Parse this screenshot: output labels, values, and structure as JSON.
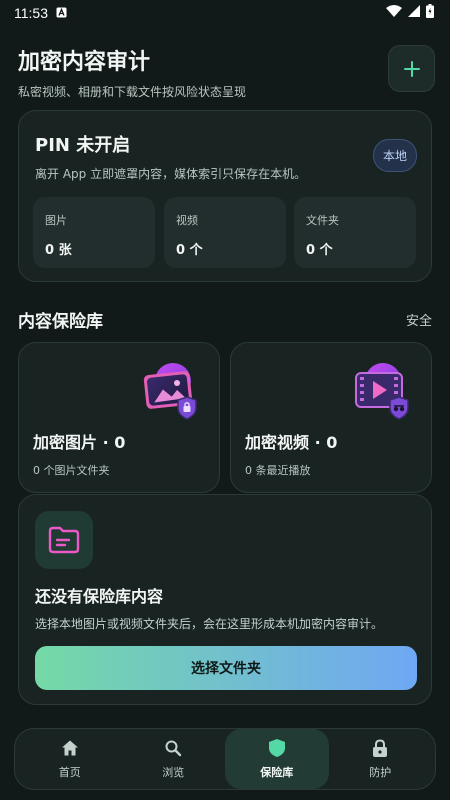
{
  "status_bar": {
    "time": "11:53",
    "icons": [
      "notification-a-icon",
      "wifi-icon",
      "signal-icon",
      "battery-icon"
    ]
  },
  "header": {
    "title": "加密内容审计",
    "subtitle": "私密视频、相册和下载文件按风险状态呈现",
    "add_icon": "plus-icon"
  },
  "pin_card": {
    "title": "PIN 未开启",
    "description": "离开 App 立即遮罩内容，媒体索引只保存在本机。",
    "badge": "本地",
    "stats": [
      {
        "label": "图片",
        "value": "0 张"
      },
      {
        "label": "视频",
        "value": "0 个"
      },
      {
        "label": "文件夹",
        "value": "0 个"
      }
    ]
  },
  "vault_section": {
    "title": "内容保险库",
    "link": "安全",
    "cards": [
      {
        "title": "加密图片 · 0",
        "subtitle": "0 个图片文件夹",
        "icon": "locked-photo-icon"
      },
      {
        "title": "加密视频 · 0",
        "subtitle": "0 条最近播放",
        "icon": "locked-video-icon"
      }
    ]
  },
  "empty_state": {
    "title": "还没有保险库内容",
    "description": "选择本地图片或视频文件夹后，会在这里形成本机加密内容审计。",
    "button": "选择文件夹",
    "icon": "folder-icon"
  },
  "bottom_nav": {
    "items": [
      {
        "label": "首页",
        "icon": "home-icon",
        "active": false
      },
      {
        "label": "浏览",
        "icon": "search-icon",
        "active": false
      },
      {
        "label": "保险库",
        "icon": "shield-icon",
        "active": true
      },
      {
        "label": "防护",
        "icon": "lock-icon",
        "active": false
      }
    ]
  },
  "colors": {
    "background": "#111a19",
    "card": "#182322",
    "accent_green": "#54d8a5",
    "gradient_start": "#74d9a6",
    "gradient_end": "#6fa7f4"
  }
}
